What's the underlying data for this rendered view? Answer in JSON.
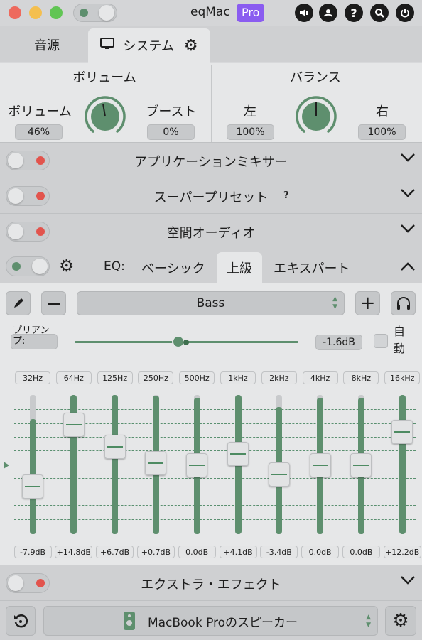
{
  "titlebar": {
    "app_name": "eqMac",
    "pro_badge": "Pro"
  },
  "tabs": [
    {
      "label": "音源"
    },
    {
      "label": "システム"
    }
  ],
  "volume": {
    "heading": "ボリューム",
    "volume_label": "ボリューム",
    "volume_value": "46%",
    "boost_label": "ブースト",
    "boost_value": "0%"
  },
  "balance": {
    "heading": "バランス",
    "left_label": "左",
    "left_value": "100%",
    "right_label": "右",
    "right_value": "100%"
  },
  "sections": {
    "mixer": "アプリケーションミキサー",
    "super_preset": "スーパープリセット",
    "super_preset_help": "?",
    "spatial": "空間オーディオ",
    "extra": "エクストラ・エフェクト"
  },
  "eq": {
    "label": "EQ:",
    "tabs": [
      {
        "label": "ベーシック"
      },
      {
        "label": "上級"
      },
      {
        "label": "エキスパート"
      }
    ],
    "preset": "Bass",
    "preamp_label": "プリアンプ:",
    "preamp_value": "-1.6dB",
    "auto_label": "自動",
    "bands": [
      {
        "freq": "32Hz",
        "gain": "-7.9dB",
        "db": -7.9
      },
      {
        "freq": "64Hz",
        "gain": "+14.8dB",
        "db": 14.8
      },
      {
        "freq": "125Hz",
        "gain": "+6.7dB",
        "db": 6.7
      },
      {
        "freq": "250Hz",
        "gain": "+0.7dB",
        "db": 0.7
      },
      {
        "freq": "500Hz",
        "gain": "0.0dB",
        "db": 0.0
      },
      {
        "freq": "1kHz",
        "gain": "+4.1dB",
        "db": 4.1
      },
      {
        "freq": "2kHz",
        "gain": "-3.4dB",
        "db": -3.4
      },
      {
        "freq": "4kHz",
        "gain": "0.0dB",
        "db": 0.0
      },
      {
        "freq": "8kHz",
        "gain": "0.0dB",
        "db": 0.0
      },
      {
        "freq": "16kHz",
        "gain": "+12.2dB",
        "db": 12.2
      }
    ]
  },
  "output": {
    "device": "MacBook Proのスピーカー"
  },
  "colors": {
    "accent": "#5e8f6e",
    "red": "#e2544d",
    "pro": "#8a5cf0"
  }
}
